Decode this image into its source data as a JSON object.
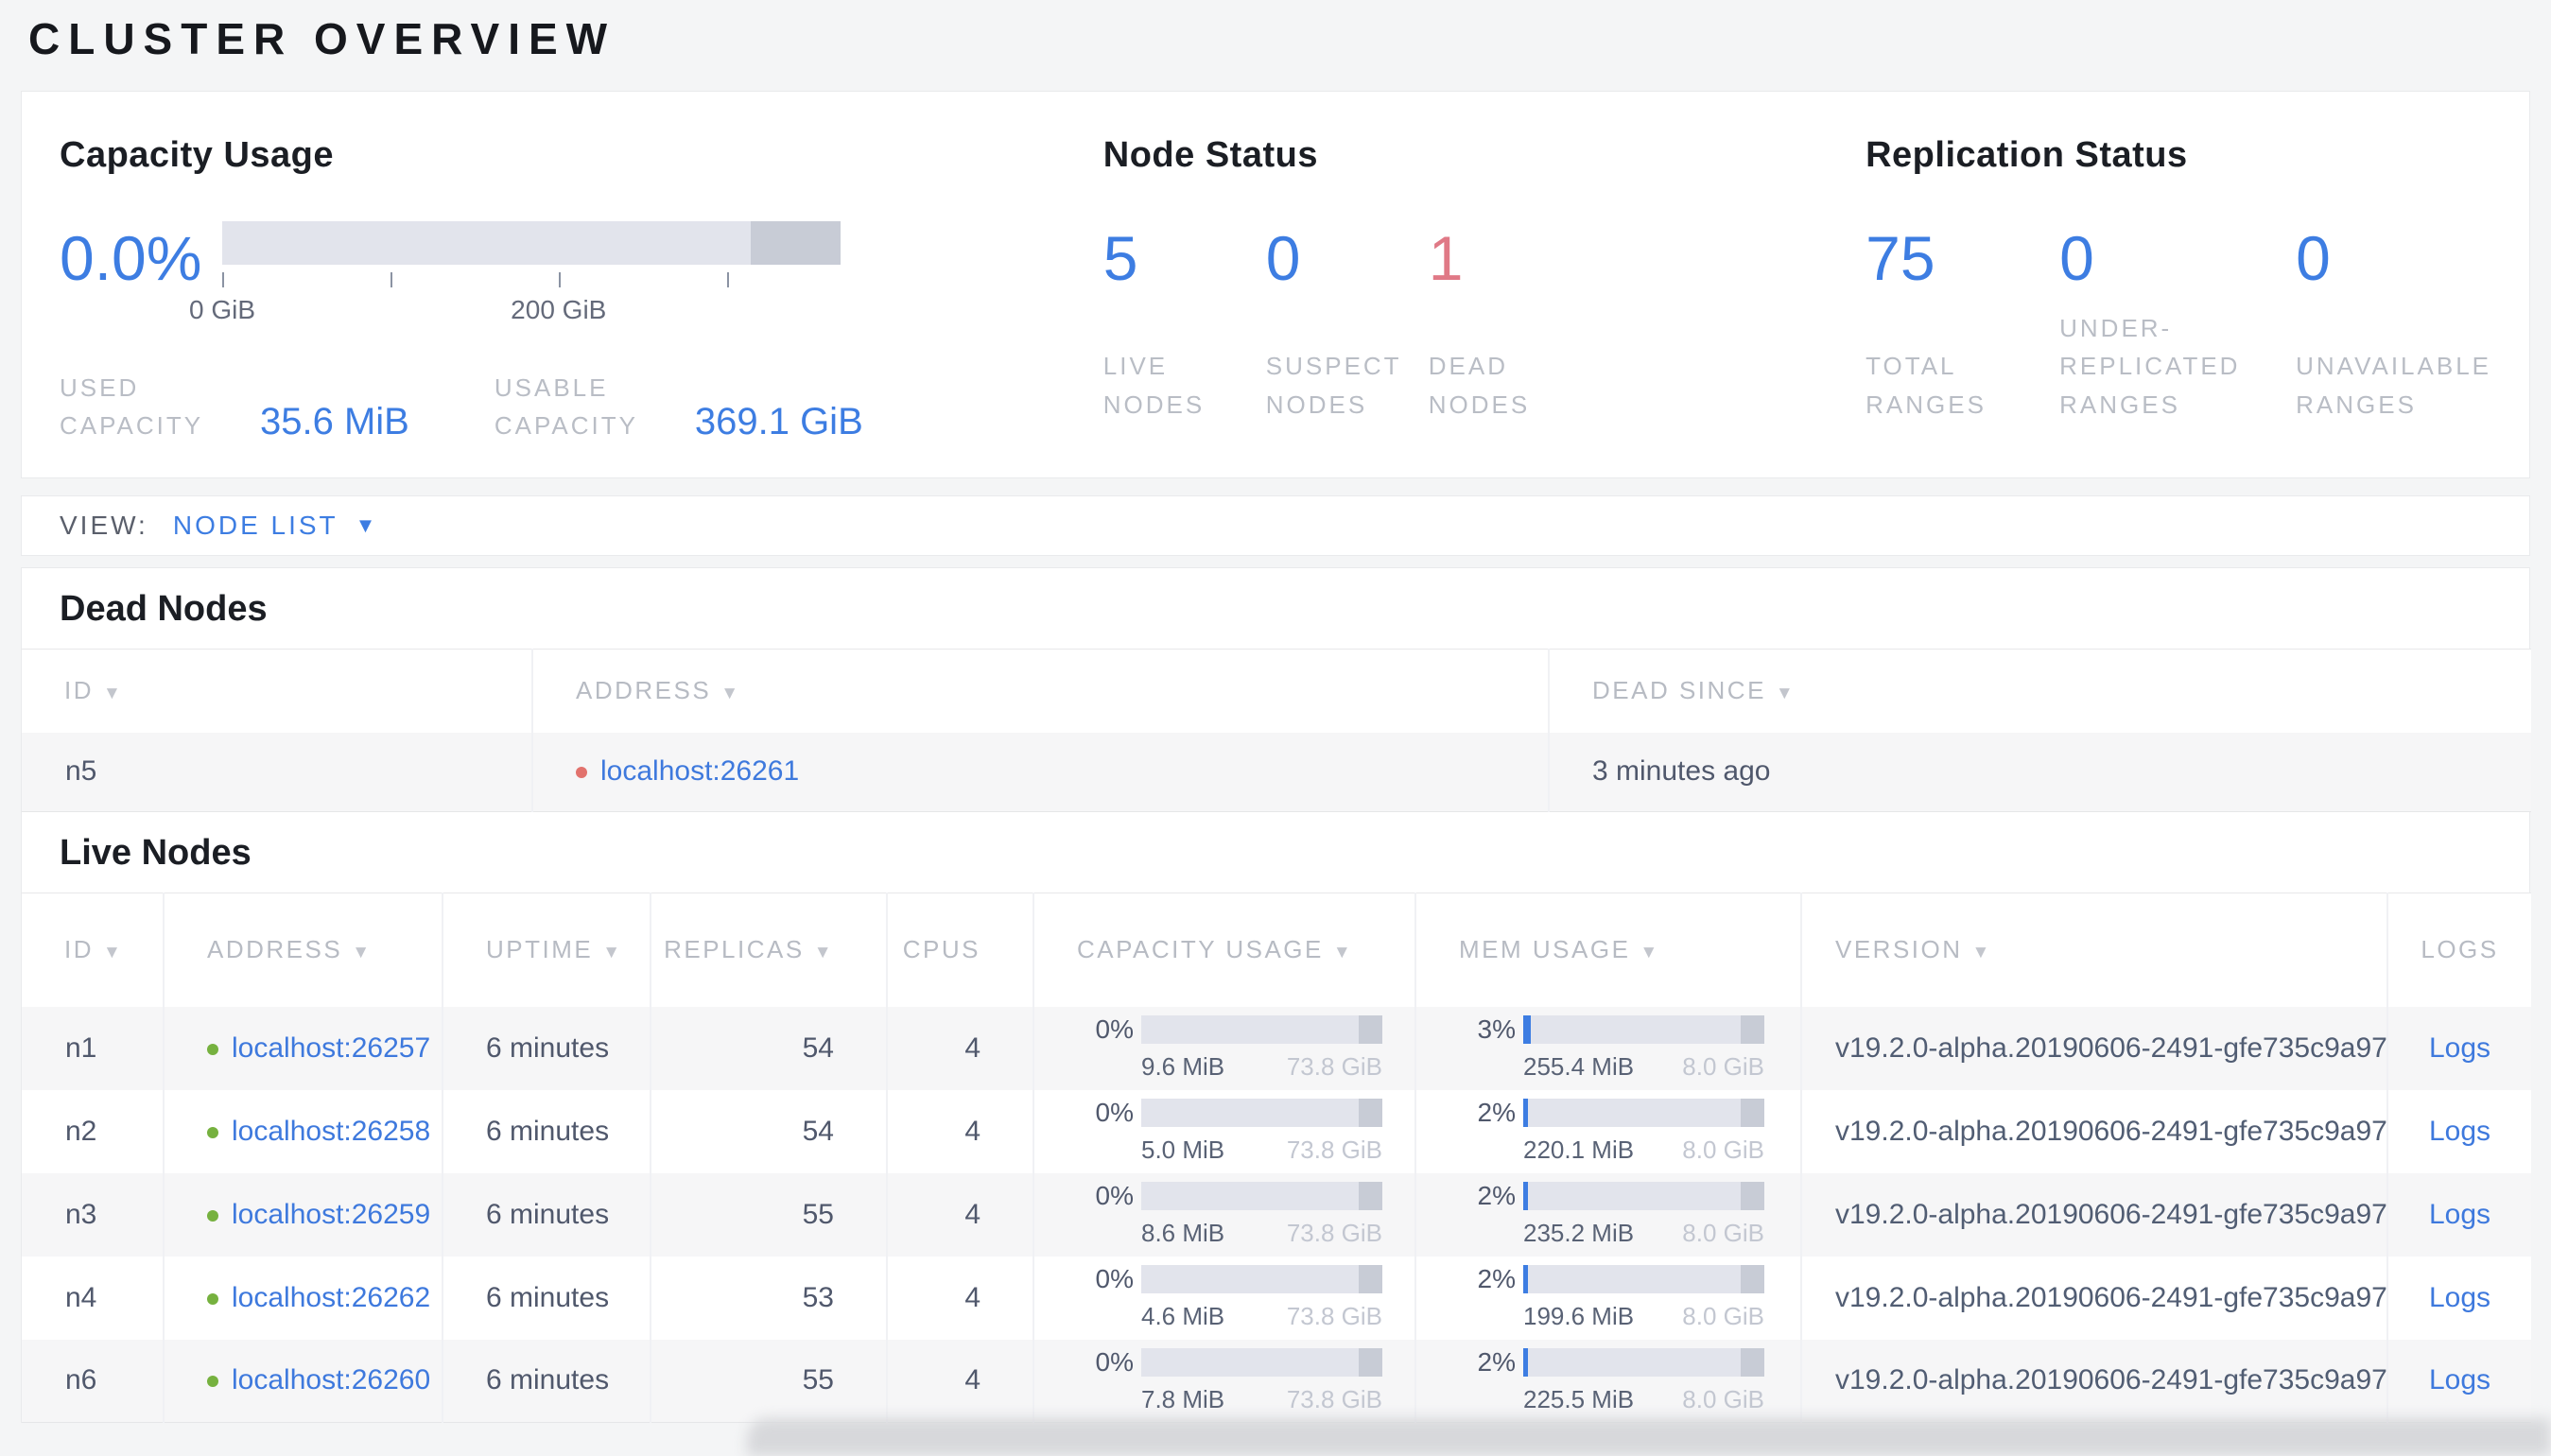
{
  "page": {
    "title": "CLUSTER OVERVIEW"
  },
  "colors": {
    "accent_blue": "#3d7de2",
    "link_blue": "#3e79dd",
    "danger_red": "#e07986",
    "live_green": "#76b13f",
    "dead_red": "#e2726d"
  },
  "summary": {
    "capacity": {
      "title": "Capacity Usage",
      "percent": "0.0%",
      "bar": {
        "fill_width": "0%",
        "reserved_left": "85.5%",
        "reserved_width": "14.5%"
      },
      "ticks": [
        {
          "pos": "0%",
          "label": "0 GiB"
        },
        {
          "pos": "27.2%",
          "label": ""
        },
        {
          "pos": "54.4%",
          "label": "200 GiB"
        },
        {
          "pos": "81.6%",
          "label": ""
        }
      ],
      "metrics": [
        {
          "label": "USED\nCAPACITY",
          "value": "35.6 MiB"
        },
        {
          "label": "USABLE\nCAPACITY",
          "value": "369.1 GiB"
        }
      ]
    },
    "node_status": {
      "title": "Node Status",
      "stats": [
        {
          "value": "5",
          "label": "LIVE\nNODES",
          "color": "#3d7de2"
        },
        {
          "value": "0",
          "label": "SUSPECT\nNODES",
          "color": "#3d7de2"
        },
        {
          "value": "1",
          "label": "DEAD\nNODES",
          "color": "#e07986"
        }
      ]
    },
    "replication": {
      "title": "Replication Status",
      "stats": [
        {
          "value": "75",
          "label": "TOTAL\nRANGES",
          "color": "#3d7de2"
        },
        {
          "value": "0",
          "label": "UNDER-\nREPLICATED\nRANGES",
          "color": "#3d7de2"
        },
        {
          "value": "0",
          "label": "UNAVAILABLE\nRANGES",
          "color": "#3d7de2"
        }
      ]
    }
  },
  "view_bar": {
    "label": "VIEW:",
    "selected": "NODE LIST"
  },
  "dead_nodes": {
    "title": "Dead Nodes",
    "columns": [
      {
        "label": "ID"
      },
      {
        "label": "ADDRESS"
      },
      {
        "label": "DEAD SINCE"
      }
    ],
    "rows": [
      {
        "id": "n5",
        "address": "localhost:26261",
        "dead_since": "3 minutes ago"
      }
    ]
  },
  "live_nodes": {
    "title": "Live Nodes",
    "columns": [
      {
        "label": "ID"
      },
      {
        "label": "ADDRESS"
      },
      {
        "label": "UPTIME"
      },
      {
        "label": "REPLICAS"
      },
      {
        "label": "CPUS"
      },
      {
        "label": "CAPACITY USAGE"
      },
      {
        "label": "MEM USAGE"
      },
      {
        "label": "VERSION"
      },
      {
        "label": "LOGS"
      }
    ],
    "rows": [
      {
        "id": "n1",
        "address": "localhost:26257",
        "uptime": "6 minutes",
        "replicas": "54",
        "cpus": "4",
        "capacity": {
          "percent": "0%",
          "fill_width": "0%",
          "used": "9.6 MiB",
          "total": "73.8 GiB"
        },
        "mem": {
          "percent": "3%",
          "fill_width": "3%",
          "used": "255.4 MiB",
          "total": "8.0 GiB"
        },
        "version": "v19.2.0-alpha.20190606-2491-gfe735c9a97",
        "logs": "Logs"
      },
      {
        "id": "n2",
        "address": "localhost:26258",
        "uptime": "6 minutes",
        "replicas": "54",
        "cpus": "4",
        "capacity": {
          "percent": "0%",
          "fill_width": "0%",
          "used": "5.0 MiB",
          "total": "73.8 GiB"
        },
        "mem": {
          "percent": "2%",
          "fill_width": "2%",
          "used": "220.1 MiB",
          "total": "8.0 GiB"
        },
        "version": "v19.2.0-alpha.20190606-2491-gfe735c9a97",
        "logs": "Logs"
      },
      {
        "id": "n3",
        "address": "localhost:26259",
        "uptime": "6 minutes",
        "replicas": "55",
        "cpus": "4",
        "capacity": {
          "percent": "0%",
          "fill_width": "0%",
          "used": "8.6 MiB",
          "total": "73.8 GiB"
        },
        "mem": {
          "percent": "2%",
          "fill_width": "2%",
          "used": "235.2 MiB",
          "total": "8.0 GiB"
        },
        "version": "v19.2.0-alpha.20190606-2491-gfe735c9a97",
        "logs": "Logs"
      },
      {
        "id": "n4",
        "address": "localhost:26262",
        "uptime": "6 minutes",
        "replicas": "53",
        "cpus": "4",
        "capacity": {
          "percent": "0%",
          "fill_width": "0%",
          "used": "4.6 MiB",
          "total": "73.8 GiB"
        },
        "mem": {
          "percent": "2%",
          "fill_width": "2%",
          "used": "199.6 MiB",
          "total": "8.0 GiB"
        },
        "version": "v19.2.0-alpha.20190606-2491-gfe735c9a97",
        "logs": "Logs"
      },
      {
        "id": "n6",
        "address": "localhost:26260",
        "uptime": "6 minutes",
        "replicas": "55",
        "cpus": "4",
        "capacity": {
          "percent": "0%",
          "fill_width": "0%",
          "used": "7.8 MiB",
          "total": "73.8 GiB"
        },
        "mem": {
          "percent": "2%",
          "fill_width": "2%",
          "used": "225.5 MiB",
          "total": "8.0 GiB"
        },
        "version": "v19.2.0-alpha.20190606-2491-gfe735c9a97",
        "logs": "Logs"
      }
    ]
  }
}
